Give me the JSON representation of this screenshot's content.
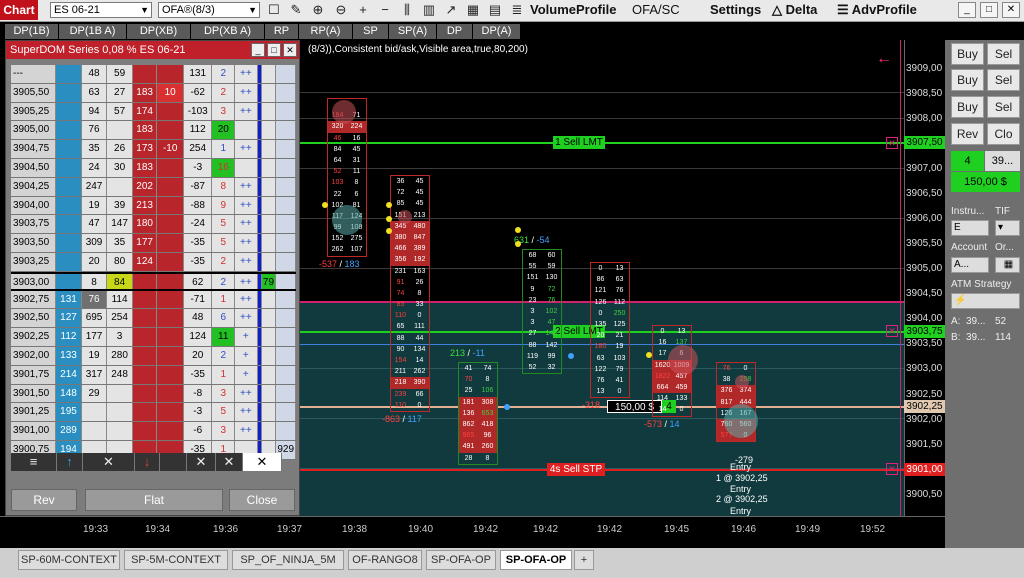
{
  "toolbar": {
    "chart_label": "Chart",
    "instrument": "ES 06-21",
    "period": "OFA®(8/3)",
    "volume_profile": "VolumeProfile",
    "ofa_sc": "OFA/SC",
    "settings": "Settings",
    "delta": "Delta",
    "adv_profile": "AdvProfile"
  },
  "indicator_tabs": [
    "DP(1B)",
    "DP(1B A)",
    "DP(XB)",
    "DP(XB A)",
    "RP",
    "RP(A)",
    "SP",
    "SP(A)",
    "DP",
    "DP(A)"
  ],
  "status_line": "(8/3)),Consistent bid/ask,Visible area,true,80,200)",
  "dom": {
    "title": "SuperDOM Series 0,08 % ES 06-21",
    "rows": [
      {
        "price": "---",
        "b1": "",
        "b2": "48",
        "b3": "59",
        "a1": "",
        "a2": "",
        "d": "131",
        "n": "2",
        "s": "++",
        "v1": "",
        "v2": ""
      },
      {
        "price": "3905,50",
        "b1": "",
        "b2": "63",
        "b3": "27",
        "a1": "183",
        "a2": "10",
        "d": "-62",
        "n": "2",
        "s": "++",
        "v1": "",
        "v2": ""
      },
      {
        "price": "3905,25",
        "b1": "",
        "b2": "94",
        "b3": "57",
        "a1": "174",
        "a2": "",
        "d": "-103",
        "n": "3",
        "s": "++",
        "v1": "",
        "v2": ""
      },
      {
        "price": "3905,00",
        "b1": "",
        "b2": "76",
        "b3": "",
        "a1": "183",
        "a2": "",
        "d": "112",
        "n": "20",
        "s": "",
        "v1": "",
        "v2": ""
      },
      {
        "price": "3904,75",
        "b1": "",
        "b2": "35",
        "b3": "26",
        "a1": "173",
        "a2": "-10",
        "d": "254",
        "n": "1",
        "s": "++",
        "v1": "",
        "v2": ""
      },
      {
        "price": "3904,50",
        "b1": "",
        "b2": "24",
        "b3": "30",
        "a1": "183",
        "a2": "",
        "d": "-3",
        "n": "16",
        "s": "",
        "v1": "",
        "v2": ""
      },
      {
        "price": "3904,25",
        "b1": "",
        "b2": "247",
        "b3": "",
        "a1": "202",
        "a2": "",
        "d": "-87",
        "n": "8",
        "s": "++",
        "v1": "",
        "v2": ""
      },
      {
        "price": "3904,00",
        "b1": "",
        "b2": "19",
        "b3": "39",
        "a1": "213",
        "a2": "",
        "d": "-88",
        "n": "9",
        "s": "++",
        "v1": "",
        "v2": ""
      },
      {
        "price": "3903,75",
        "b1": "",
        "b2": "47",
        "b3": "147",
        "a1": "180",
        "a2": "",
        "d": "-24",
        "n": "5",
        "s": "++",
        "v1": "",
        "v2": ""
      },
      {
        "price": "3903,50",
        "b1": "",
        "b2": "309",
        "b3": "35",
        "a1": "177",
        "a2": "",
        "d": "-35",
        "n": "5",
        "s": "++",
        "v1": "",
        "v2": ""
      },
      {
        "price": "3903,25",
        "b1": "",
        "b2": "20",
        "b3": "80",
        "a1": "124",
        "a2": "",
        "d": "-35",
        "n": "2",
        "s": "++",
        "v1": "",
        "v2": ""
      },
      {
        "price": "3903,00",
        "b1": "",
        "b2": "8",
        "b3": "84",
        "a1": "",
        "a2": "",
        "d": "62",
        "n": "2",
        "s": "++",
        "v1": "79",
        "v2": ""
      },
      {
        "price": "3902,75",
        "b1": "131",
        "b2": "76",
        "b3": "114",
        "a1": "",
        "a2": "",
        "d": "-71",
        "n": "1",
        "s": "++",
        "v1": "",
        "v2": ""
      },
      {
        "price": "3902,50",
        "b1": "127",
        "b2": "695",
        "b3": "254",
        "a1": "",
        "a2": "",
        "d": "48",
        "n": "6",
        "s": "++",
        "v1": "",
        "v2": ""
      },
      {
        "price": "3902,25",
        "b1": "112",
        "b2": "177",
        "b3": "3",
        "a1": "",
        "a2": "",
        "d": "124",
        "n": "11",
        "s": "+",
        "v1": "",
        "v2": ""
      },
      {
        "price": "3902,00",
        "b1": "133",
        "b2": "19",
        "b3": "280",
        "a1": "",
        "a2": "",
        "d": "20",
        "n": "2",
        "s": "+",
        "v1": "",
        "v2": ""
      },
      {
        "price": "3901,75",
        "b1": "214",
        "b2": "317",
        "b3": "248",
        "a1": "",
        "a2": "",
        "d": "-35",
        "n": "1",
        "s": "+",
        "v1": "",
        "v2": ""
      },
      {
        "price": "3901,50",
        "b1": "148",
        "b2": "29",
        "b3": "",
        "a1": "",
        "a2": "",
        "d": "-8",
        "n": "3",
        "s": "++",
        "v1": "",
        "v2": ""
      },
      {
        "price": "3901,25",
        "b1": "195",
        "b2": "",
        "b3": "",
        "a1": "",
        "a2": "",
        "d": "-3",
        "n": "5",
        "s": "++",
        "v1": "",
        "v2": ""
      },
      {
        "price": "3901,00",
        "b1": "289",
        "b2": "",
        "b3": "",
        "a1": "",
        "a2": "",
        "d": "-6",
        "n": "3",
        "s": "++",
        "v1": "",
        "v2": ""
      },
      {
        "price": "3900,75",
        "b1": "194",
        "b2": "",
        "b3": "",
        "a1": "",
        "a2": "",
        "d": "-35",
        "n": "1",
        "s": "",
        "v1": "",
        "v2": "929"
      }
    ],
    "rev_label": "Rev",
    "flat_label": "Flat",
    "close_label": "Close"
  },
  "orders": {
    "sell_lmt_1": "1  Sell LMT",
    "sell_lmt_2": "2  Sell LMT",
    "sell_stp": "4s  Sell STP",
    "position_pnl": "150,00 $",
    "position_qty": "4",
    "entry1_title": "Entry",
    "entry1": "1 @ 3902,25",
    "entry2_title": "Entry",
    "entry2": "2 @ 3902,25",
    "entry_delta": "-279"
  },
  "price_axis": [
    "3909,00",
    "3908,75",
    "3908,50",
    "3908,25",
    "3908,00",
    "3907,75",
    "3907,50",
    "3907,25",
    "3907,00",
    "3906,75",
    "3906,50",
    "3906,25",
    "3906,00",
    "3905,75",
    "3905,50",
    "3905,25",
    "3905,00",
    "3904,75",
    "3904,50",
    "3904,25",
    "3904,00",
    "3903,75",
    "3903,50",
    "3903,25",
    "3903,00",
    "3902,75",
    "3902,50",
    "3902,25",
    "3902,00",
    "3901,75",
    "3901,50",
    "3901,25",
    "3901,00",
    "3900,75",
    "3900,50"
  ],
  "price_tags": {
    "sell_lmt_1": "3907,50",
    "sell_lmt_2": "3903,75",
    "entry": "3902,25",
    "sell_stp": "3901,00",
    "last": "3903,00"
  },
  "time_axis": [
    "19:33",
    "19:34",
    "19:36",
    "19:37",
    "19:38",
    "19:40",
    "19:42",
    "19:42",
    "19:42",
    "19:45",
    "19:46",
    "19:49",
    "19:52"
  ],
  "bottom_tabs": [
    "SP-60M-CONTEXT",
    "SP-5M-CONTEXT",
    "SP_OF_NINJA_5M",
    "OF-RANGO8",
    "SP-OFA-OP",
    "SP-OFA-OP"
  ],
  "add_tab": "+",
  "right_panel": {
    "buy": "Buy",
    "sell": "Sel",
    "rev": "Rev",
    "close": "Clo",
    "qty": "4",
    "price": "39...",
    "pnl": "150,00 $",
    "instrument_label": "Instru...",
    "tif_label": "TIF",
    "instrument_value": "E",
    "account_label": "Account",
    "order_label": "Or...",
    "account_value": "A...",
    "atm_label": "ATM Strategy",
    "a_label": "A:",
    "a_price": "39...",
    "a_qty": "52",
    "b_label": "B:",
    "b_price": "39...",
    "b_qty": "114"
  },
  "footprints": [
    {
      "rows": [
        [
          "",
          ""
        ],
        [
          "184",
          "71"
        ],
        [
          "320",
          "224"
        ],
        [
          "46",
          "16"
        ],
        [
          "84",
          "45"
        ],
        [
          "64",
          "31"
        ],
        [
          "52",
          "11"
        ],
        [
          "103",
          "8"
        ],
        [
          "22",
          "6"
        ],
        [
          "102",
          "81"
        ],
        [
          "117",
          "124"
        ],
        [
          "99",
          "108"
        ],
        [
          "152",
          "275"
        ],
        [
          "262",
          "107"
        ]
      ],
      "delta": "-537",
      "vol": "183"
    },
    {
      "rows": [
        [
          "36",
          "45"
        ],
        [
          "72",
          "45"
        ],
        [
          "85",
          "45"
        ],
        [
          "151",
          "213"
        ],
        [
          "345",
          "480"
        ],
        [
          "380",
          "847"
        ],
        [
          "466",
          "389"
        ],
        [
          "356",
          "192"
        ],
        [
          "231",
          "163"
        ],
        [
          "91",
          "26"
        ],
        [
          "74",
          "8"
        ],
        [
          "85",
          "33"
        ],
        [
          "110",
          "0"
        ],
        [
          "65",
          "111"
        ],
        [
          "88",
          "44"
        ],
        [
          "90",
          "134"
        ],
        [
          "154",
          "14"
        ],
        [
          "211",
          "262"
        ],
        [
          "218",
          "390"
        ],
        [
          "239",
          "66"
        ],
        [
          "110",
          "0"
        ]
      ],
      "delta": "-863",
      "vol": "117"
    },
    {
      "rows": [
        [
          "41",
          "74"
        ],
        [
          "70",
          "8"
        ],
        [
          "25",
          "106"
        ],
        [
          "181",
          "308"
        ],
        [
          "136",
          "653"
        ],
        [
          "862",
          "418"
        ],
        [
          "965",
          "96"
        ],
        [
          "491",
          "260"
        ],
        [
          "28",
          "8"
        ]
      ],
      "delta": "213",
      "vol": "-11"
    },
    {
      "rows": [
        [
          "68",
          "60"
        ],
        [
          "55",
          "59"
        ],
        [
          "151",
          "130"
        ],
        [
          "9",
          "72"
        ],
        [
          "23",
          "76"
        ],
        [
          "3",
          "102"
        ],
        [
          "3",
          "47"
        ],
        [
          "27",
          "148"
        ],
        [
          "88",
          "142"
        ],
        [
          "119",
          "99"
        ],
        [
          "52",
          "32"
        ]
      ],
      "delta": "631",
      "vol": "-54"
    },
    {
      "rows": [
        [
          "0",
          "13"
        ],
        [
          "86",
          "63"
        ],
        [
          "121",
          "76"
        ],
        [
          "126",
          "112"
        ],
        [
          "0",
          "250"
        ],
        [
          "135",
          "125"
        ],
        [
          "20",
          "21"
        ],
        [
          "180",
          "19"
        ],
        [
          "63",
          "103"
        ],
        [
          "122",
          "79"
        ],
        [
          "76",
          "41"
        ],
        [
          "13",
          "0"
        ]
      ],
      "delta": "-318",
      "vol": ""
    },
    {
      "rows": [
        [
          "0",
          "13"
        ],
        [
          "16",
          "137"
        ],
        [
          "17",
          "6"
        ],
        [
          "1620",
          "1009"
        ],
        [
          "1822",
          "457"
        ],
        [
          "664",
          "459"
        ],
        [
          "114",
          "133"
        ],
        [
          "14",
          "0"
        ]
      ],
      "delta": "-573",
      "vol": "14"
    },
    {
      "rows": [
        [
          "76",
          "0"
        ],
        [
          "38",
          "258"
        ],
        [
          "376",
          "374"
        ],
        [
          "817",
          "444"
        ],
        [
          "126",
          "167"
        ],
        [
          "760",
          "560"
        ],
        [
          "577",
          "0"
        ]
      ],
      "delta": "",
      "vol": ""
    }
  ]
}
